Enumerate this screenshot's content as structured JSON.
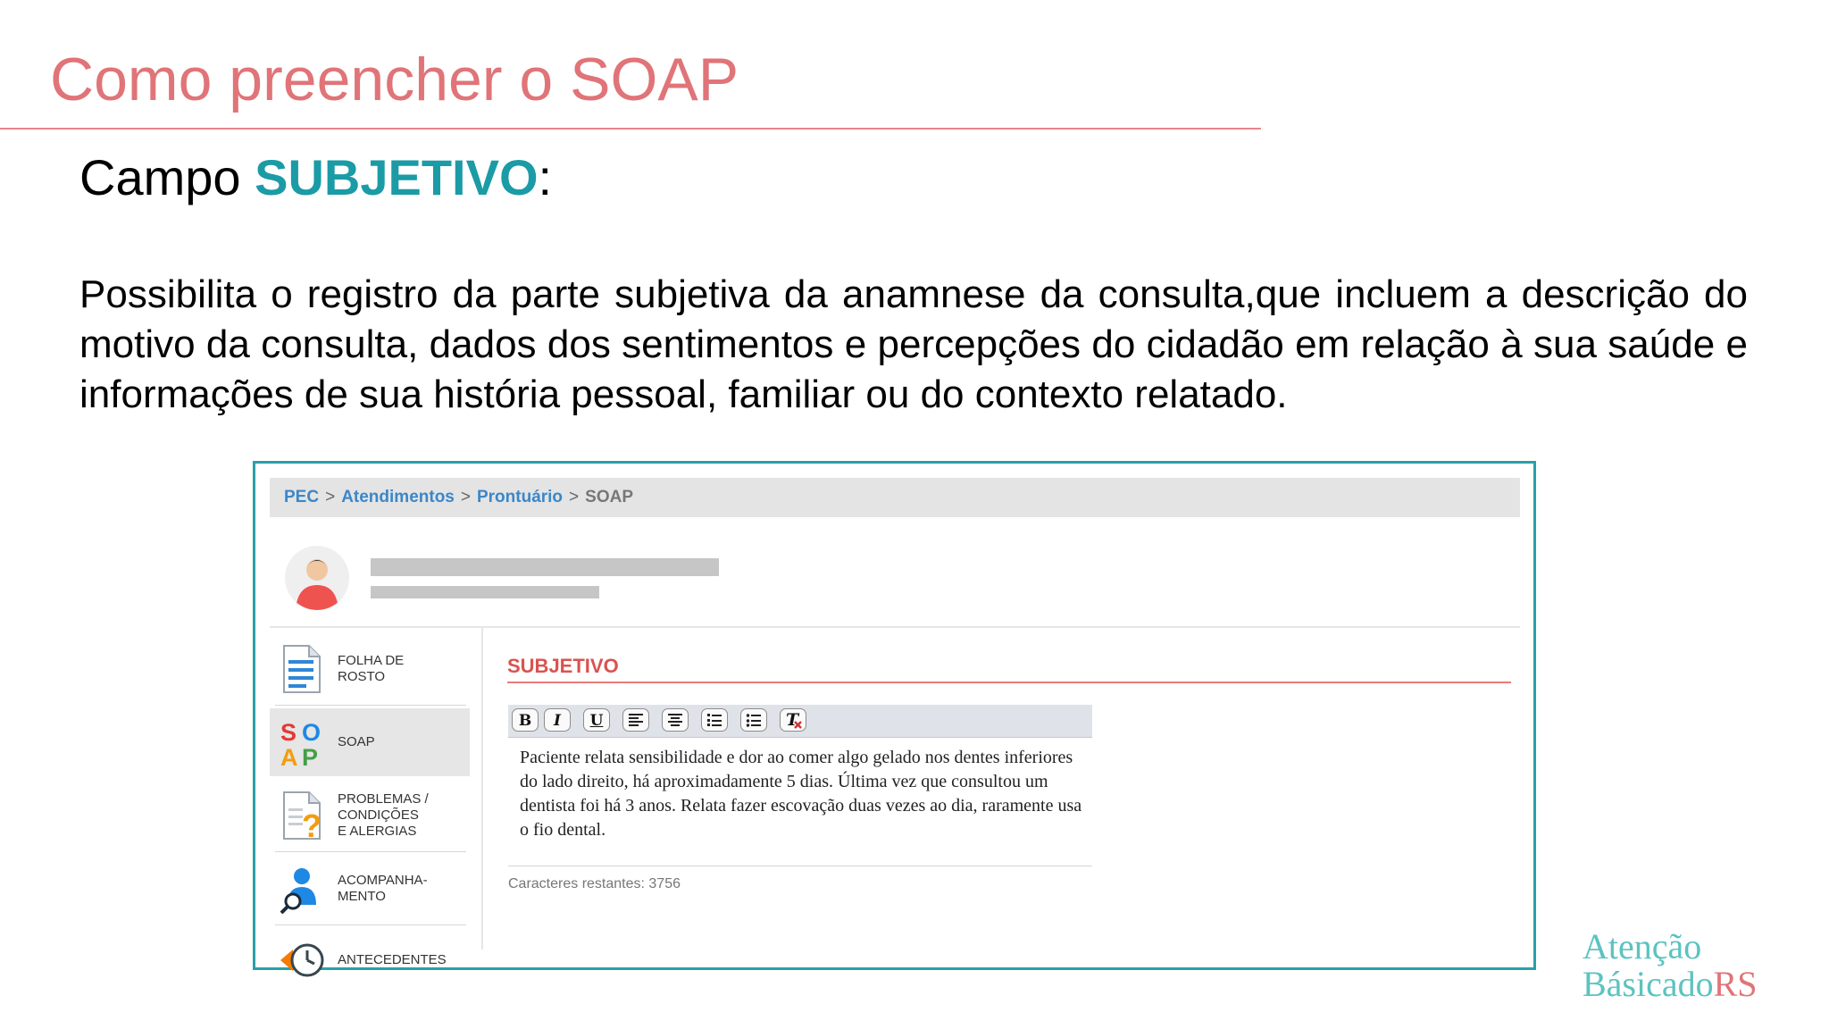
{
  "slide": {
    "title": "Como preencher o SOAP",
    "subheading_prefix": "Campo ",
    "subheading_highlight": "SUBJETIVO",
    "subheading_suffix": ":",
    "body": "Possibilita o registro da parte subjetiva da anamnese da consulta,que incluem a descrição do motivo da consulta, dados dos sentimentos e percepções do cidadão em relação à sua saúde e informações de sua história pessoal, familiar ou do contexto relatado."
  },
  "app": {
    "breadcrumb": {
      "items": [
        "PEC",
        "Atendimentos",
        "Prontuário"
      ],
      "separator": ">",
      "current": "SOAP"
    },
    "sidebar": {
      "items": [
        {
          "label": "FOLHA DE\nROSTO",
          "icon": "document-icon"
        },
        {
          "label": "SOAP",
          "icon": "soap-icon",
          "active": true
        },
        {
          "label": "PROBLEMAS /\nCONDIÇÕES\nE ALERGIAS",
          "icon": "question-document-icon"
        },
        {
          "label": "ACOMPANHA-\nMENTO",
          "icon": "person-search-icon"
        },
        {
          "label": "ANTECEDENTES",
          "icon": "history-clock-icon"
        }
      ],
      "soap_letters": [
        "S",
        "O",
        "A",
        "P"
      ]
    },
    "section": {
      "title": "SUBJETIVO",
      "toolbar": [
        "B",
        "I",
        "U",
        "align-left",
        "align-center",
        "numbered-list",
        "bulleted-list",
        "clear-format"
      ],
      "text": "Paciente relata sensibilidade e dor ao comer algo gelado nos dentes inferiores do lado direito, há aproximadamente 5 dias. Última vez que consultou um dentista foi há 3 anos. Relata fazer escovação duas vezes ao dia, raramente usa o fio dental.",
      "counter": "Caracteres restantes: 3756"
    }
  },
  "brand": {
    "line1": "Atenção",
    "line2_a": "Básica",
    "line2_b": "do",
    "line2_c": "RS"
  },
  "colors": {
    "title": "#e07478",
    "highlight": "#1b9ba6",
    "frame": "#2aa0a8",
    "link": "#3b87c8",
    "section": "#d9534f"
  }
}
